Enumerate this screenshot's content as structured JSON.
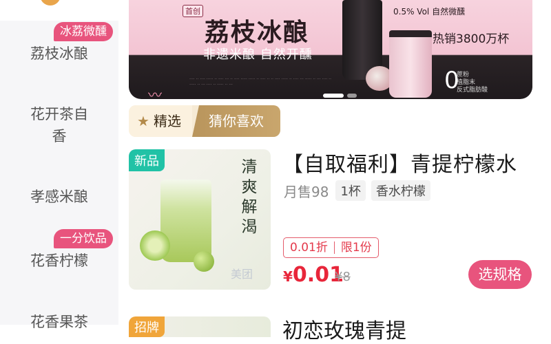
{
  "sidebar": {
    "items": [
      {
        "label": "荔枝冰酿",
        "badge": "冰荔微醺"
      },
      {
        "label": "花开茶自香",
        "badge": ""
      },
      {
        "label": "孝感米酿",
        "badge": ""
      },
      {
        "label": "花香柠檬",
        "badge": "一分饮品"
      },
      {
        "label": "花香果茶",
        "badge": ""
      }
    ]
  },
  "banner": {
    "tag": "首创",
    "title": "荔枝冰酿",
    "subtitle": "非遗米酿 自然开醺",
    "volume_note": "0.5% Vol 自然微醺",
    "sales_note": "热销3800万杯",
    "zero_value": "0",
    "zero_notes": [
      "蔗粉",
      "植脂末",
      "反式脂肪酸"
    ],
    "carousel_count": 2,
    "carousel_active": 1
  },
  "tabs": [
    {
      "label": "精选",
      "icon": "star-icon",
      "active": true
    },
    {
      "label": "猜你喜欢",
      "active": false
    }
  ],
  "product": {
    "badge": "新品",
    "slogan": "清爽解渴",
    "title": "【自取福利】青提柠檬水",
    "sales": "月售98",
    "chips": [
      "1杯",
      "香水柠檬"
    ],
    "discount": "0.01折",
    "limit": "限1份",
    "currency": "¥",
    "price": "0.01",
    "original_price": "¥8",
    "spec_button": "选规格",
    "watermark": "美团"
  },
  "next_product": {
    "badge": "招牌",
    "title": "初恋玫瑰青提"
  },
  "colors": {
    "accent_pink": "#e8547d",
    "price_red": "#e8263a",
    "new_badge": "#21c2a6",
    "tab_gold": "#b9955c"
  }
}
